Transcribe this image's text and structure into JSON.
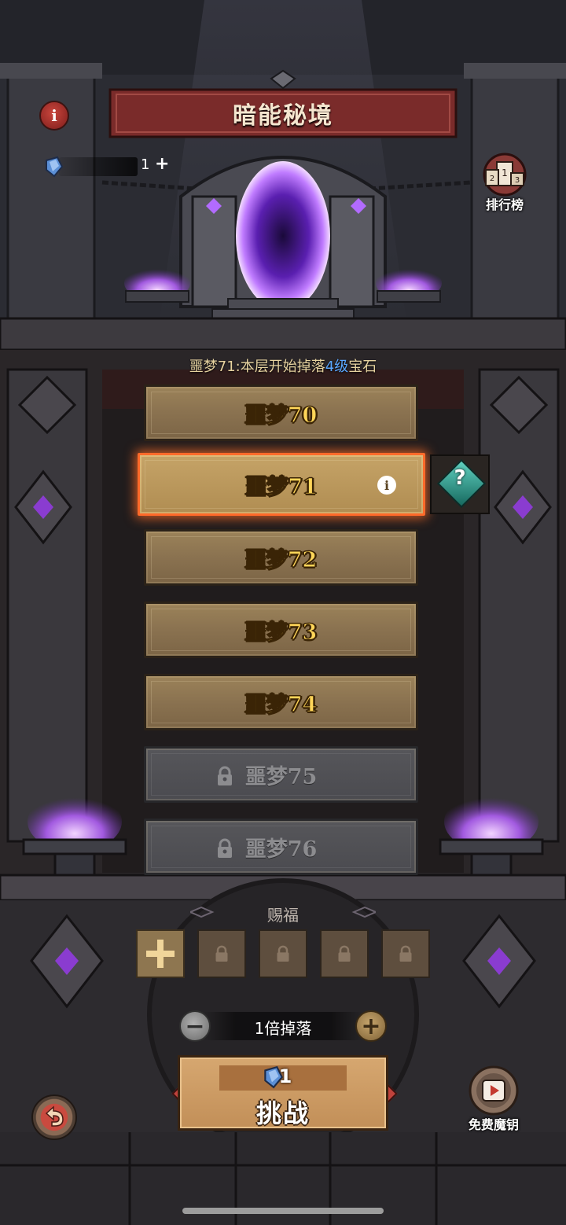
{
  "header": {
    "title": "暗能秘境",
    "info_icon": "info-icon",
    "currency_count": "1",
    "currency_plus": "+",
    "ranking_label": "排行榜"
  },
  "floor_info": {
    "prefix": "噩梦71:",
    "text1": "本层开始掉落",
    "highlight": "4级",
    "text2": "宝石"
  },
  "levels": [
    {
      "label": "噩梦70",
      "state": "unlocked"
    },
    {
      "label": "噩梦71",
      "state": "selected"
    },
    {
      "label": "噩梦72",
      "state": "unlocked"
    },
    {
      "label": "噩梦73",
      "state": "unlocked"
    },
    {
      "label": "噩梦74",
      "state": "unlocked"
    },
    {
      "label": "噩梦75",
      "state": "locked"
    },
    {
      "label": "噩梦76",
      "state": "locked"
    }
  ],
  "help_button": "?",
  "blessing": {
    "title": "赐福",
    "slots": [
      "add",
      "locked",
      "locked",
      "locked",
      "locked"
    ]
  },
  "multiplier": {
    "label": "1倍掉落",
    "minus": "−",
    "plus": "+"
  },
  "challenge": {
    "cost": "1",
    "label": "挑战"
  },
  "free_key_label": "免费魔钥",
  "colors": {
    "level_gold_text": "#ffd659",
    "locked_text": "#8c8c8f",
    "selected_glow": "#ff6a2a",
    "highlight_blue": "#5aa7ff"
  }
}
